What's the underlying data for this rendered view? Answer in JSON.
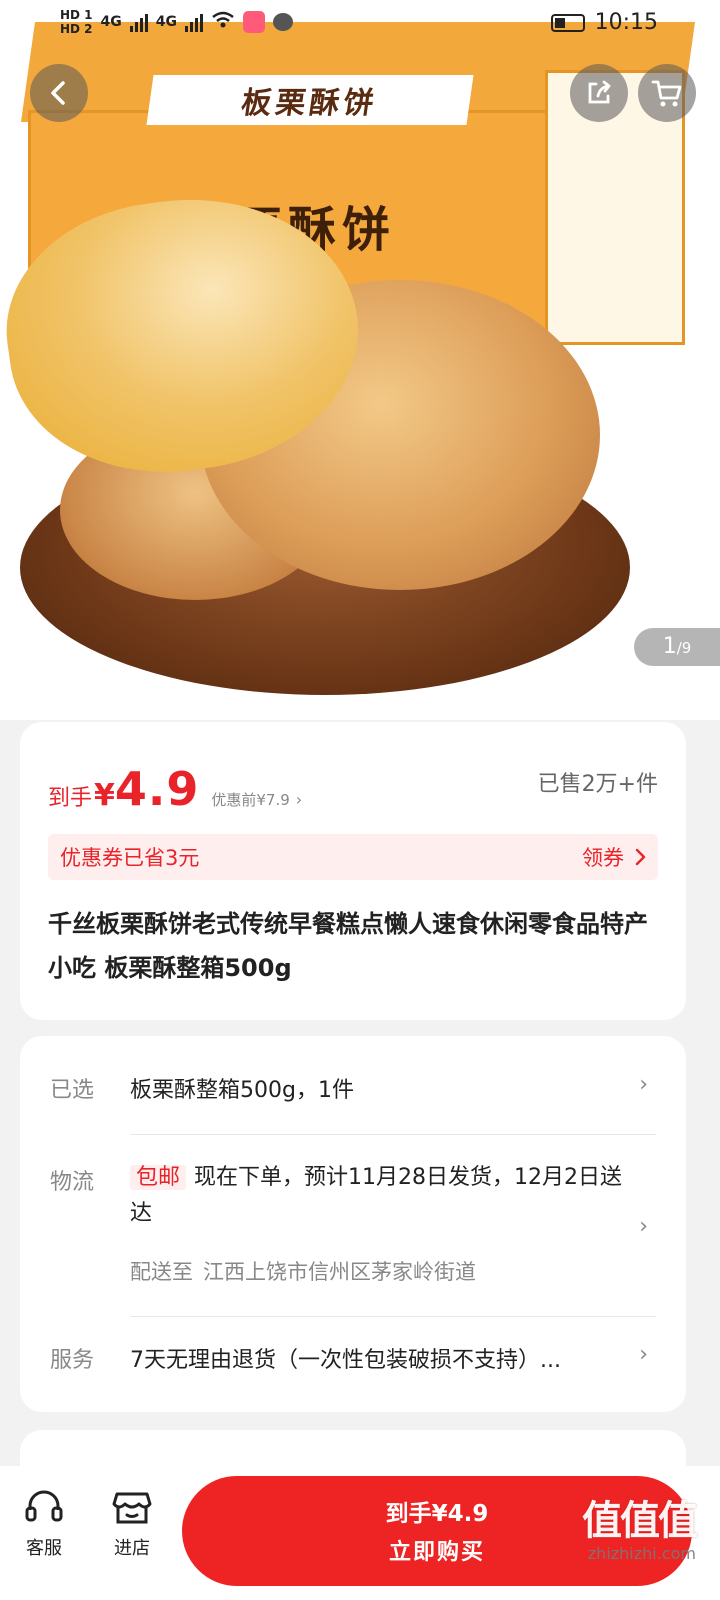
{
  "status_bar": {
    "sim1": "HD 1",
    "sim2": "HD 2",
    "net1": "4G",
    "net2": "4G",
    "time": "10:15"
  },
  "hero": {
    "box_label": "板栗酥饼",
    "box_title": "板栗酥饼",
    "brand": "千丝",
    "pager_current": "1",
    "pager_total": "/9"
  },
  "price": {
    "label": "到手",
    "currency": "¥",
    "amount": "4.9",
    "before": "优惠前¥7.9",
    "sold": "已售2万+件"
  },
  "coupon": {
    "text": "优惠券已省3元",
    "action": "领券"
  },
  "product": {
    "title": "千丝板栗酥饼老式传统早餐糕点懒人速食休闲零食品特产小吃 板栗酥整箱500g"
  },
  "details": {
    "selected": {
      "key": "已选",
      "value": "板栗酥整箱500g，1件"
    },
    "logistics": {
      "key": "物流",
      "badge": "包邮",
      "text": "现在下单，预计11月28日发货，12月2日送达",
      "addr_label": "配送至",
      "addr": "江西上饶市信州区茅家岭街道"
    },
    "service": {
      "key": "服务",
      "value": "7天无理由退货（一次性包装破损不支持）..."
    }
  },
  "bottom_bar": {
    "support_label": "客服",
    "store_label": "进店",
    "buy_price": "到手¥4.9",
    "buy_action": "立即购买"
  },
  "watermark": {
    "logo": "值值值",
    "url": "zhizhizhi.com"
  },
  "colors": {
    "accent": "#e8242a",
    "button": "#ee2424",
    "coupon_bg": "#ffeeee",
    "page_bg": "#f2f2f2"
  },
  "icons": {
    "back": "chevron-left-icon",
    "share": "share-icon",
    "cart": "cart-icon",
    "support": "headset-icon",
    "store": "store-icon"
  }
}
